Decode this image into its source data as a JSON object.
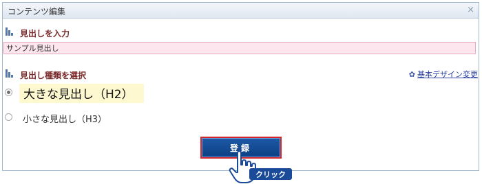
{
  "window": {
    "title": "コンテンツ編集",
    "close_label": "×"
  },
  "heading_section": {
    "label": "見出しを入力",
    "input_value": "サンプル見出し"
  },
  "type_section": {
    "label": "見出し種類を選択",
    "design_link": "基本デザイン変更",
    "options": [
      {
        "label": "大きな見出し（H2）",
        "selected": true
      },
      {
        "label": "小さな見出し（H3）",
        "selected": false
      }
    ]
  },
  "submit": {
    "label": "登録"
  },
  "annotation": {
    "label": "クリック"
  },
  "colors": {
    "accent": "#0d3f82",
    "section_label": "#7a2a2a",
    "input_bg": "#fde6ee",
    "highlight": "#fdf8cf",
    "button_border": "#d4232b"
  },
  "icons": [
    "close-icon",
    "section-icon",
    "gear-icon",
    "radio-icon",
    "hand-cursor-icon"
  ]
}
